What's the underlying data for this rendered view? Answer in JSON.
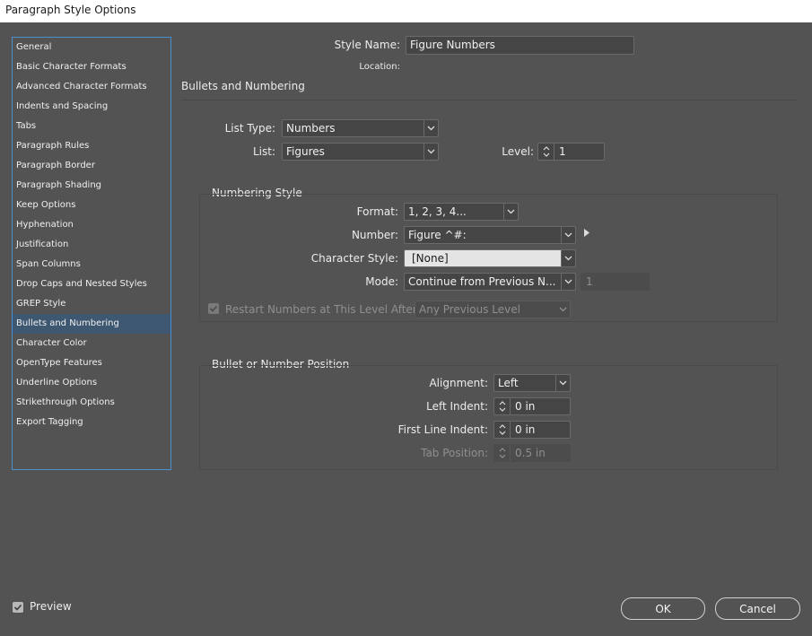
{
  "window": {
    "title": "Paragraph Style Options"
  },
  "sidebar": {
    "items": [
      {
        "label": "General"
      },
      {
        "label": "Basic Character Formats"
      },
      {
        "label": "Advanced Character Formats"
      },
      {
        "label": "Indents and Spacing"
      },
      {
        "label": "Tabs"
      },
      {
        "label": "Paragraph Rules"
      },
      {
        "label": "Paragraph Border"
      },
      {
        "label": "Paragraph Shading"
      },
      {
        "label": "Keep Options"
      },
      {
        "label": "Hyphenation"
      },
      {
        "label": "Justification"
      },
      {
        "label": "Span Columns"
      },
      {
        "label": "Drop Caps and Nested Styles"
      },
      {
        "label": "GREP Style"
      },
      {
        "label": "Bullets and Numbering",
        "selected": true
      },
      {
        "label": "Character Color"
      },
      {
        "label": "OpenType Features"
      },
      {
        "label": "Underline Options"
      },
      {
        "label": "Strikethrough Options"
      },
      {
        "label": "Export Tagging"
      }
    ]
  },
  "header": {
    "style_name_label": "Style Name:",
    "style_name_value": "Figure Numbers",
    "location_label": "Location:",
    "section_title": "Bullets and Numbering"
  },
  "list": {
    "list_type_label": "List Type:",
    "list_type_value": "Numbers",
    "list_label": "List:",
    "list_value": "Figures",
    "level_label": "Level:",
    "level_value": "1"
  },
  "numbering_style": {
    "title": "Numbering Style",
    "format_label": "Format:",
    "format_value": "1, 2, 3, 4...",
    "number_label": "Number:",
    "number_value": "Figure ^#:",
    "char_style_label": "Character Style:",
    "char_style_value": "[None]",
    "mode_label": "Mode:",
    "mode_value": "Continue from Previous N...",
    "mode_start_value": "1",
    "restart_label": "Restart Numbers at This Level After:",
    "restart_checked": true,
    "restart_value": "Any Previous Level"
  },
  "position": {
    "title": "Bullet or Number Position",
    "alignment_label": "Alignment:",
    "alignment_value": "Left",
    "left_indent_label": "Left Indent:",
    "left_indent_value": "0 in",
    "first_line_indent_label": "First Line Indent:",
    "first_line_indent_value": "0 in",
    "tab_position_label": "Tab Position:",
    "tab_position_value": "0.5 in"
  },
  "footer": {
    "preview_label": "Preview",
    "preview_checked": true,
    "ok_label": "OK",
    "cancel_label": "Cancel"
  },
  "colors": {
    "background": "#535353",
    "sidebar_selected": "#3e5871",
    "sidebar_border": "#4c8fd1",
    "field_bg": "#454545"
  },
  "icons": {
    "dropdown": "chevron-down-icon",
    "spinner": "up-down-arrows-icon",
    "flyout": "triangle-right-icon",
    "checkbox": "check-icon"
  }
}
